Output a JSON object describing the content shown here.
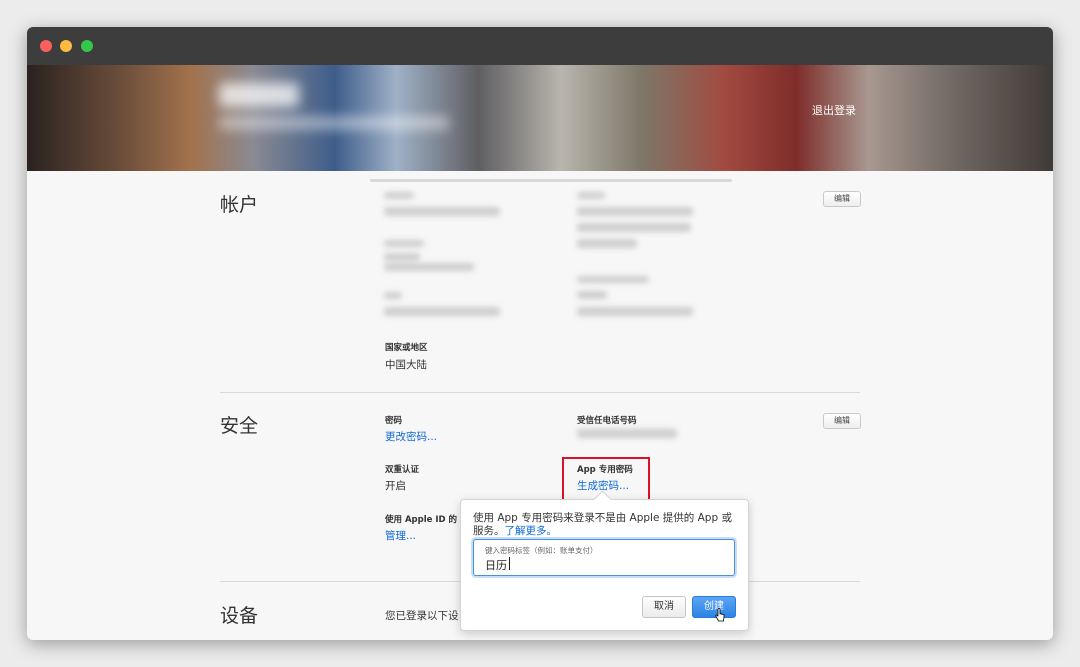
{
  "banner": {
    "logout_label": "退出登录"
  },
  "account": {
    "title": "帐户",
    "edit_label": "编辑",
    "country_label": "国家或地区",
    "country_value": "中国大陆"
  },
  "security": {
    "title": "安全",
    "edit_label": "编辑",
    "password_label": "密码",
    "password_link": "更改密码...",
    "trusted_phone_label": "受信任电话号码",
    "two_factor_label": "双重认证",
    "two_factor_value": "开启",
    "app_password_label": "App 专用密码",
    "app_password_link": "生成密码...",
    "apple_id_label": "使用 Apple ID 的 A",
    "apple_id_link": "管理..."
  },
  "devices": {
    "title": "设备",
    "text": "您已登录以下设"
  },
  "popover": {
    "description": "使用 App 专用密码来登录不是由 Apple 提供的 App 或服务。",
    "learn_more": "了解更多。",
    "input_placeholder": "键入密码标签（例如：账单支付）",
    "input_value": "日历",
    "cancel_label": "取消",
    "create_label": "创建"
  },
  "colors": {
    "link": "#0f6ad8",
    "highlight": "#d9112a",
    "primary_button": "#2c83e4"
  }
}
